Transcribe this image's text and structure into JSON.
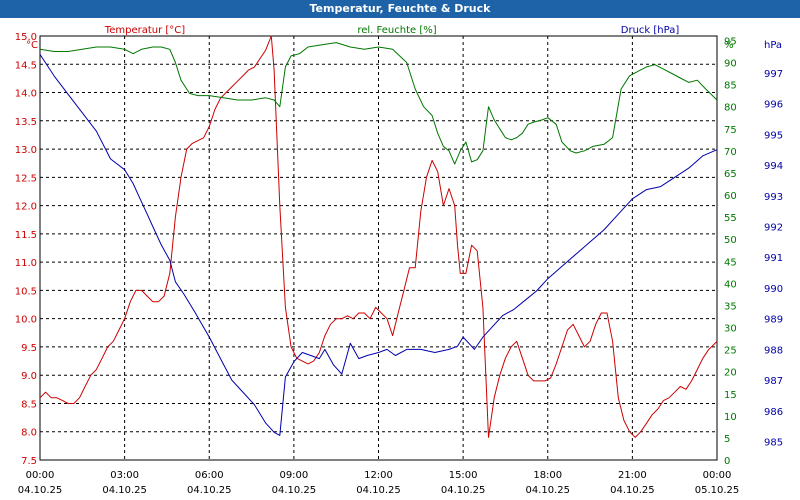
{
  "chart_data": {
    "type": "line",
    "title": "Temperatur, Feuchte & Druck",
    "x": [
      "00:00\n04.10.25",
      "03:00\n04.10.25",
      "06:00\n04.10.25",
      "09:00\n04.10.25",
      "12:00\n04.10.25",
      "15:00\n04.10.25",
      "18:00\n04.10.25",
      "21:00\n04.10.25",
      "00:00\n05.10.25"
    ],
    "x_tick_times": [
      "00:00",
      "03:00",
      "06:00",
      "09:00",
      "12:00",
      "15:00",
      "18:00",
      "21:00",
      "00:00"
    ],
    "x_tick_dates": [
      "04.10.25",
      "04.10.25",
      "04.10.25",
      "04.10.25",
      "04.10.25",
      "04.10.25",
      "04.10.25",
      "04.10.25",
      "05.10.25"
    ],
    "xlim": [
      "04.10.25 00:00",
      "05.10.25 00:00"
    ],
    "grid": true,
    "axes": {
      "temperature": {
        "label": "Temperatur [°C]",
        "unit": "°C",
        "side": "left",
        "color": "#cc0000",
        "ylim": [
          7.5,
          15.0
        ],
        "ticks": [
          "7.5",
          "8.0",
          "8.5",
          "9.0",
          "9.5",
          "10.0",
          "10.5",
          "11.0",
          "11.5",
          "12.0",
          "12.5",
          "13.0",
          "13.5",
          "14.0",
          "14.5",
          "15.0"
        ]
      },
      "humidity": {
        "label": "rel. Feuchte [%]",
        "unit": "%",
        "side": "right",
        "color": "#007700",
        "ylim": [
          0,
          96
        ],
        "ticks": [
          "0",
          "5",
          "10",
          "15",
          "20",
          "25",
          "30",
          "35",
          "40",
          "45",
          "50",
          "55",
          "60",
          "65",
          "70",
          "75",
          "80",
          "85",
          "90",
          "95"
        ]
      },
      "pressure": {
        "label": "Druck [hPa]",
        "unit": "hPa",
        "side": "right",
        "color": "#0000aa",
        "ylim": [
          984.4,
          998.2
        ],
        "ticks": [
          "985",
          "986",
          "987",
          "988",
          "989",
          "990",
          "991",
          "992",
          "993",
          "994",
          "995",
          "996",
          "997"
        ]
      }
    },
    "series": [
      {
        "name": "Temperatur [°C]",
        "axis": "temperature",
        "color": "#cc0000",
        "points": [
          [
            0,
            8.6
          ],
          [
            0.2,
            8.7
          ],
          [
            0.4,
            8.6
          ],
          [
            0.6,
            8.6
          ],
          [
            0.8,
            8.55
          ],
          [
            1,
            8.5
          ],
          [
            1.2,
            8.5
          ],
          [
            1.4,
            8.6
          ],
          [
            1.6,
            8.8
          ],
          [
            1.8,
            9.0
          ],
          [
            2,
            9.1
          ],
          [
            2.2,
            9.3
          ],
          [
            2.4,
            9.5
          ],
          [
            2.6,
            9.6
          ],
          [
            2.8,
            9.8
          ],
          [
            3,
            10.0
          ],
          [
            3.2,
            10.3
          ],
          [
            3.4,
            10.5
          ],
          [
            3.6,
            10.5
          ],
          [
            3.8,
            10.4
          ],
          [
            4,
            10.3
          ],
          [
            4.2,
            10.3
          ],
          [
            4.4,
            10.4
          ],
          [
            4.6,
            10.8
          ],
          [
            4.8,
            11.8
          ],
          [
            5,
            12.5
          ],
          [
            5.2,
            13.0
          ],
          [
            5.4,
            13.1
          ],
          [
            5.6,
            13.15
          ],
          [
            5.8,
            13.2
          ],
          [
            6,
            13.4
          ],
          [
            6.2,
            13.7
          ],
          [
            6.4,
            13.9
          ],
          [
            6.6,
            14.0
          ],
          [
            6.8,
            14.1
          ],
          [
            7,
            14.2
          ],
          [
            7.2,
            14.3
          ],
          [
            7.4,
            14.4
          ],
          [
            7.6,
            14.45
          ],
          [
            7.8,
            14.6
          ],
          [
            8,
            14.75
          ],
          [
            8.2,
            15.0
          ],
          [
            8.3,
            14.4
          ],
          [
            8.5,
            12.0
          ],
          [
            8.7,
            10.2
          ],
          [
            8.9,
            9.5
          ],
          [
            9.1,
            9.3
          ],
          [
            9.3,
            9.25
          ],
          [
            9.5,
            9.2
          ],
          [
            9.7,
            9.25
          ],
          [
            9.9,
            9.4
          ],
          [
            10.1,
            9.7
          ],
          [
            10.3,
            9.9
          ],
          [
            10.5,
            10.0
          ],
          [
            10.7,
            10.0
          ],
          [
            10.9,
            10.05
          ],
          [
            11.1,
            10.0
          ],
          [
            11.3,
            10.1
          ],
          [
            11.5,
            10.1
          ],
          [
            11.7,
            10.0
          ],
          [
            11.9,
            10.2
          ],
          [
            12.1,
            10.1
          ],
          [
            12.3,
            10.0
          ],
          [
            12.5,
            9.7
          ],
          [
            12.7,
            10.1
          ],
          [
            12.9,
            10.5
          ],
          [
            13.1,
            10.9
          ],
          [
            13.3,
            10.9
          ],
          [
            13.5,
            11.9
          ],
          [
            13.7,
            12.5
          ],
          [
            13.9,
            12.8
          ],
          [
            14.1,
            12.6
          ],
          [
            14.3,
            12.0
          ],
          [
            14.5,
            12.3
          ],
          [
            14.7,
            12.0
          ],
          [
            14.8,
            11.3
          ],
          [
            14.9,
            10.8
          ],
          [
            15.1,
            10.8
          ],
          [
            15.3,
            11.3
          ],
          [
            15.5,
            11.2
          ],
          [
            15.7,
            10.2
          ],
          [
            15.9,
            7.9
          ],
          [
            16.1,
            8.6
          ],
          [
            16.3,
            9.0
          ],
          [
            16.5,
            9.3
          ],
          [
            16.7,
            9.5
          ],
          [
            16.9,
            9.6
          ],
          [
            17.1,
            9.3
          ],
          [
            17.3,
            9.0
          ],
          [
            17.5,
            8.9
          ],
          [
            17.7,
            8.9
          ],
          [
            17.9,
            8.9
          ],
          [
            18.1,
            8.95
          ],
          [
            18.3,
            9.2
          ],
          [
            18.5,
            9.5
          ],
          [
            18.7,
            9.8
          ],
          [
            18.9,
            9.9
          ],
          [
            19.1,
            9.7
          ],
          [
            19.3,
            9.5
          ],
          [
            19.5,
            9.6
          ],
          [
            19.7,
            9.9
          ],
          [
            19.9,
            10.1
          ],
          [
            20.1,
            10.1
          ],
          [
            20.3,
            9.6
          ],
          [
            20.5,
            8.6
          ],
          [
            20.7,
            8.2
          ],
          [
            20.9,
            8.0
          ],
          [
            21.1,
            7.9
          ],
          [
            21.3,
            8.0
          ],
          [
            21.5,
            8.15
          ],
          [
            21.7,
            8.3
          ],
          [
            21.9,
            8.4
          ],
          [
            22.1,
            8.55
          ],
          [
            22.3,
            8.6
          ],
          [
            22.5,
            8.7
          ],
          [
            22.7,
            8.8
          ],
          [
            22.9,
            8.75
          ],
          [
            23.1,
            8.9
          ],
          [
            23.3,
            9.1
          ],
          [
            23.5,
            9.3
          ],
          [
            23.7,
            9.45
          ],
          [
            23.9,
            9.55
          ],
          [
            24,
            9.6
          ]
        ]
      },
      {
        "name": "rel. Feuchte [%]",
        "axis": "humidity",
        "color": "#007700",
        "points": [
          [
            0,
            93
          ],
          [
            0.5,
            92.5
          ],
          [
            1,
            92.5
          ],
          [
            1.5,
            93
          ],
          [
            2,
            93.5
          ],
          [
            2.5,
            93.5
          ],
          [
            3,
            93
          ],
          [
            3.3,
            92
          ],
          [
            3.6,
            93
          ],
          [
            4,
            93.5
          ],
          [
            4.3,
            93.5
          ],
          [
            4.6,
            93
          ],
          [
            4.8,
            90
          ],
          [
            5,
            86
          ],
          [
            5.3,
            83
          ],
          [
            5.6,
            82.5
          ],
          [
            6,
            82.5
          ],
          [
            6.5,
            82
          ],
          [
            7,
            81.5
          ],
          [
            7.5,
            81.5
          ],
          [
            8,
            82
          ],
          [
            8.3,
            81.5
          ],
          [
            8.5,
            80
          ],
          [
            8.7,
            89
          ],
          [
            8.9,
            91.5
          ],
          [
            9.2,
            92
          ],
          [
            9.5,
            93.5
          ],
          [
            10,
            94
          ],
          [
            10.5,
            94.5
          ],
          [
            11,
            93.5
          ],
          [
            11.5,
            93
          ],
          [
            12,
            93.5
          ],
          [
            12.5,
            93
          ],
          [
            13,
            90
          ],
          [
            13.3,
            84
          ],
          [
            13.6,
            80
          ],
          [
            13.9,
            78
          ],
          [
            14.1,
            74
          ],
          [
            14.3,
            71
          ],
          [
            14.5,
            70
          ],
          [
            14.7,
            67
          ],
          [
            14.9,
            70
          ],
          [
            15.1,
            72
          ],
          [
            15.3,
            67.5
          ],
          [
            15.5,
            68
          ],
          [
            15.7,
            70
          ],
          [
            15.9,
            80
          ],
          [
            16.1,
            77
          ],
          [
            16.3,
            75
          ],
          [
            16.5,
            73
          ],
          [
            16.7,
            72.5
          ],
          [
            16.9,
            73
          ],
          [
            17.1,
            74
          ],
          [
            17.3,
            76
          ],
          [
            17.5,
            76.5
          ],
          [
            17.8,
            77
          ],
          [
            18,
            77.5
          ],
          [
            18.3,
            76
          ],
          [
            18.5,
            72
          ],
          [
            18.8,
            70
          ],
          [
            19,
            69.5
          ],
          [
            19.3,
            70
          ],
          [
            19.6,
            71
          ],
          [
            20,
            71.5
          ],
          [
            20.3,
            73
          ],
          [
            20.6,
            84
          ],
          [
            20.9,
            87
          ],
          [
            21.2,
            88
          ],
          [
            21.5,
            89
          ],
          [
            21.8,
            89.5
          ],
          [
            22.1,
            88.5
          ],
          [
            22.4,
            87.5
          ],
          [
            22.7,
            86.5
          ],
          [
            23,
            85.5
          ],
          [
            23.3,
            86
          ],
          [
            23.6,
            84
          ],
          [
            24,
            81.5
          ]
        ]
      },
      {
        "name": "Druck [hPa]",
        "axis": "pressure",
        "color": "#0000aa",
        "points": [
          [
            0,
            997.6
          ],
          [
            0.5,
            996.9
          ],
          [
            1,
            996.3
          ],
          [
            1.5,
            995.7
          ],
          [
            2,
            995.1
          ],
          [
            2.5,
            994.2
          ],
          [
            3,
            993.85
          ],
          [
            3.3,
            993.4
          ],
          [
            3.5,
            993.0
          ],
          [
            3.8,
            992.4
          ],
          [
            4,
            992.0
          ],
          [
            4.3,
            991.4
          ],
          [
            4.6,
            990.9
          ],
          [
            4.8,
            990.2
          ],
          [
            5.1,
            989.8
          ],
          [
            5.5,
            989.2
          ],
          [
            6,
            988.4
          ],
          [
            6.4,
            987.7
          ],
          [
            6.8,
            987.0
          ],
          [
            7.2,
            986.6
          ],
          [
            7.6,
            986.2
          ],
          [
            8,
            985.6
          ],
          [
            8.3,
            985.3
          ],
          [
            8.5,
            985.2
          ],
          [
            8.7,
            987.1
          ],
          [
            9,
            987.6
          ],
          [
            9.3,
            987.9
          ],
          [
            9.6,
            987.8
          ],
          [
            9.9,
            987.7
          ],
          [
            10.1,
            988.0
          ],
          [
            10.4,
            987.5
          ],
          [
            10.7,
            987.2
          ],
          [
            11,
            988.2
          ],
          [
            11.3,
            987.7
          ],
          [
            11.6,
            987.8
          ],
          [
            12,
            987.9
          ],
          [
            12.3,
            988.0
          ],
          [
            12.6,
            987.8
          ],
          [
            13,
            988.0
          ],
          [
            13.5,
            988.0
          ],
          [
            14,
            987.9
          ],
          [
            14.5,
            988.0
          ],
          [
            14.8,
            988.1
          ],
          [
            15,
            988.4
          ],
          [
            15.2,
            988.2
          ],
          [
            15.4,
            988.0
          ],
          [
            15.7,
            988.4
          ],
          [
            16,
            988.7
          ],
          [
            16.4,
            989.1
          ],
          [
            16.8,
            989.3
          ],
          [
            17.2,
            989.6
          ],
          [
            17.6,
            989.9
          ],
          [
            18,
            990.3
          ],
          [
            18.5,
            990.7
          ],
          [
            19,
            991.1
          ],
          [
            19.5,
            991.5
          ],
          [
            20,
            991.9
          ],
          [
            20.5,
            992.4
          ],
          [
            21,
            992.9
          ],
          [
            21.5,
            993.2
          ],
          [
            22,
            993.3
          ],
          [
            22.5,
            993.6
          ],
          [
            23,
            993.9
          ],
          [
            23.5,
            994.3
          ],
          [
            24,
            994.5
          ]
        ]
      }
    ]
  }
}
